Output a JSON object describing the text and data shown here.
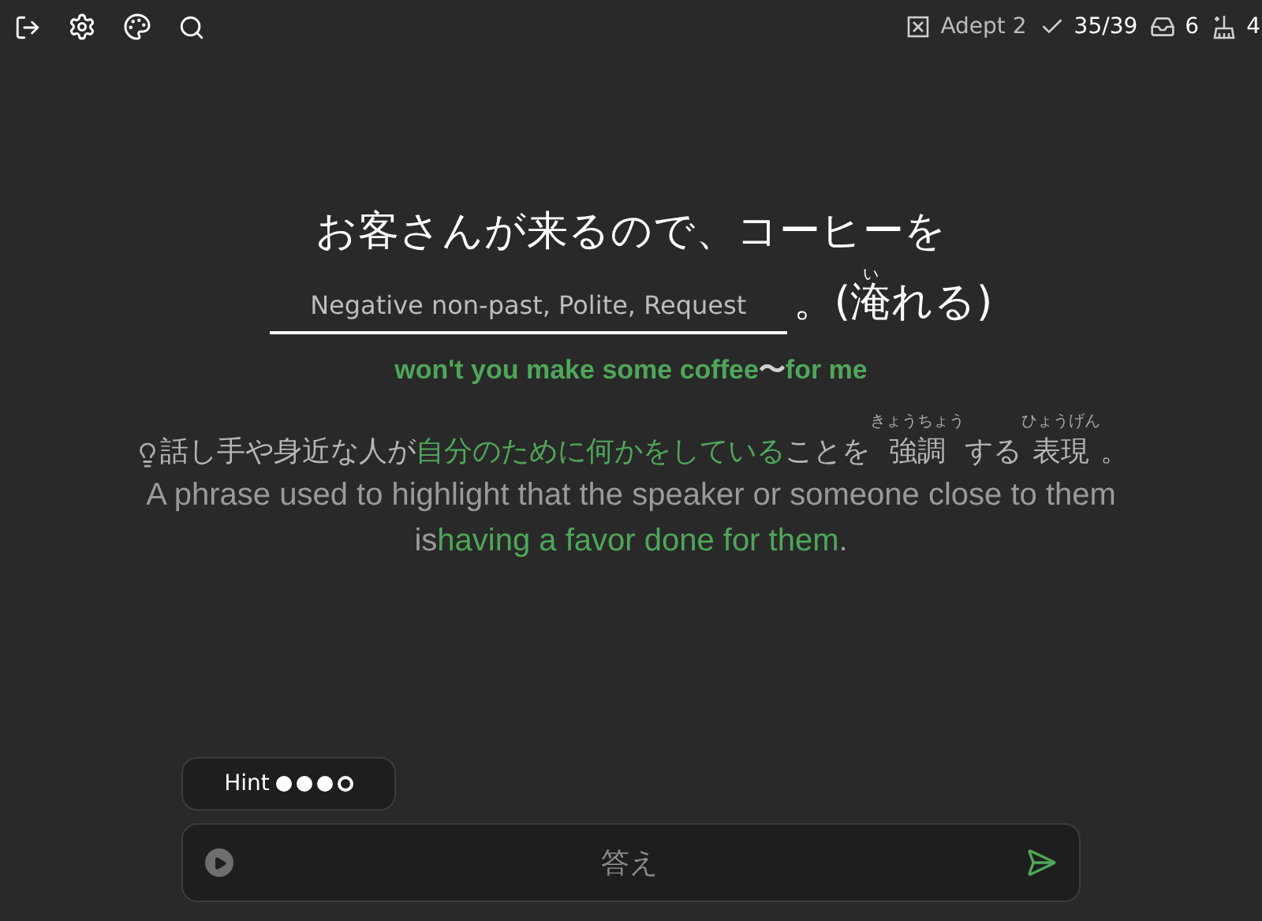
{
  "toolbar": {
    "status": [
      {
        "kind": "level",
        "text": "Adept 2"
      },
      {
        "kind": "done",
        "text": "35/39"
      },
      {
        "kind": "inbox",
        "text": "6"
      },
      {
        "kind": "clean",
        "text": "4"
      }
    ]
  },
  "sentence": {
    "line_1": "お客さんが来るので、コーヒーを",
    "blank_placeholder": "Negative non-past, Polite, Request",
    "after": [
      {
        "text": "。"
      },
      {
        "text": "("
      },
      {
        "text": "淹",
        "ruby": "い"
      },
      {
        "text": "れる)"
      }
    ]
  },
  "translation": [
    {
      "text": "won't you make some coffee",
      "highlight": true
    },
    {
      "text": "〜",
      "highlight": false
    },
    {
      "text": "for me",
      "highlight": true
    }
  ],
  "explanation_ja": [
    {
      "text": "話し手や身近な人が",
      "highlight": false
    },
    {
      "text": "自分のために何かをしている",
      "highlight": true
    },
    {
      "text": "ことを",
      "highlight": false
    },
    {
      "text": "強調",
      "ruby": "きょうちょう",
      "highlight": false
    },
    {
      "text": "する",
      "highlight": false
    },
    {
      "text": "表現",
      "ruby": "ひょうげん",
      "highlight": false
    },
    {
      "text": "。",
      "highlight": false
    }
  ],
  "explanation_en": [
    {
      "text": "A phrase used to highlight that the speaker or someone close to them is",
      "highlight": false
    },
    {
      "text": "having a favor done for them",
      "highlight": true
    },
    {
      "text": ".",
      "highlight": false
    }
  ],
  "hint": {
    "label": "Hint",
    "dots": [
      {
        "filled": true
      },
      {
        "filled": true
      },
      {
        "filled": true
      },
      {
        "filled": false
      }
    ]
  },
  "answer": {
    "placeholder": "答え"
  }
}
